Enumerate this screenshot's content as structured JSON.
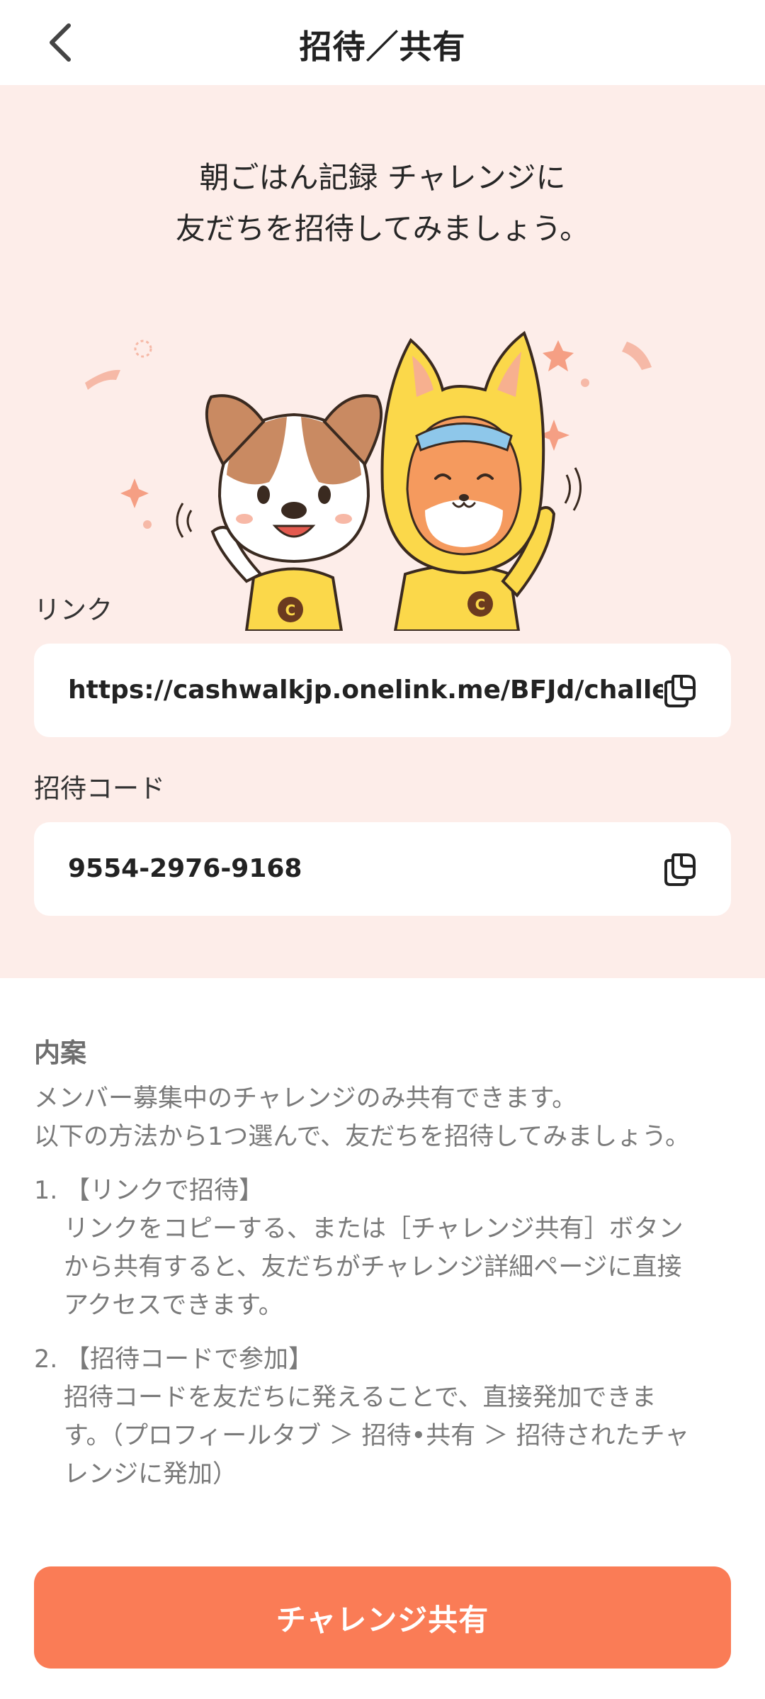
{
  "header": {
    "title": "招待／共有"
  },
  "hero": {
    "line1": "朝ごはん記録 チャレンジに",
    "line2": "友だちを招待してみましょう。"
  },
  "link": {
    "label": "リンク",
    "value": "https://cashwalkjp.onelink.me/BFJd/challe"
  },
  "code": {
    "label": "招待コード",
    "value": "9554-2976-9168"
  },
  "info": {
    "title": "内案",
    "line1": "メンバー募集中のチャレンジのみ共有できます。",
    "line2": "以下の方法から1つ選んで、友だちを招待してみましょう。",
    "items": [
      {
        "num": "1.",
        "head": "【リンクで招待】",
        "body1": "リンクをコピーする、または［チャレンジ共有］ボタン",
        "body2": "から共有すると、友だちがチャレンジ詳細ページに直接",
        "body3": "アクセスできます。"
      },
      {
        "num": "2.",
        "head": "【招待コードで参加】",
        "body1": "招待コードを友だちに発えることで、直接発加できま",
        "body2": "す。（プロフィールタブ ＞ 招待•共有 ＞ 招待されたチャ",
        "body3": "レンジに発加）"
      }
    ]
  },
  "share_button": {
    "label": "チャレンジ共有"
  },
  "colors": {
    "accent": "#fa7c56",
    "hero_bg": "#fdede9",
    "mascot_yellow": "#fbd84a",
    "dog_brown": "#c98a62"
  }
}
